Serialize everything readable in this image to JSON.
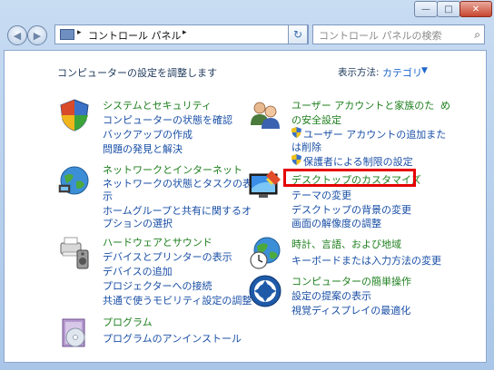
{
  "window": {
    "minimize_glyph": "—",
    "maximize_glyph": "□",
    "close_glyph": "✕"
  },
  "nav": {
    "back_glyph": "◀",
    "forward_glyph": "▶",
    "breadcrumb": "コントロール パネル",
    "sep_glyph": "▸",
    "dropdown_glyph": "▾",
    "refresh_glyph": "↻",
    "search_placeholder": "コントロール パネルの検索",
    "search_glyph": "⌕"
  },
  "header": {
    "heading": "コンピューターの設定を調整します",
    "view_label": "表示方法:",
    "view_value": "カテゴリ",
    "view_dropdown_glyph": "▼"
  },
  "categories": {
    "system": {
      "title": "システムとセキュリティ",
      "links": [
        "コンピューターの状態を確認",
        "バックアップの作成",
        "問題の発見と解決"
      ]
    },
    "network": {
      "title": "ネットワークとインターネット",
      "links": [
        "ネットワークの状態とタスクの表",
        "示",
        "ホームグループと共有に関するオ",
        "プションの選択"
      ]
    },
    "hardware": {
      "title": "ハードウェアとサウンド",
      "links": [
        "デバイスとプリンターの表示",
        "デバイスの追加",
        "プロジェクターへの接続",
        "共通で使うモビリティ設定の調整"
      ]
    },
    "programs": {
      "title": "プログラム",
      "links": [
        "プログラムのアンインストール"
      ]
    },
    "users": {
      "title_line1": "ユーザー アカウントと家族のた",
      "title_line2": "め",
      "title_line3": "の安全設定",
      "links": [
        "ユーザー アカウントの追加また",
        "は削除",
        "保護者による制限の設定"
      ]
    },
    "appearance": {
      "title": "デスクトップのカスタマイズ",
      "links": [
        "テーマの変更",
        "デスクトップの背景の変更",
        "画面の解像度の調整"
      ]
    },
    "clock": {
      "title": "時計、言語、および地域",
      "links": [
        "キーボードまたは入力方法の変更"
      ]
    },
    "ease": {
      "title": "コンピューターの簡単操作",
      "links": [
        "設定の提案の表示",
        "視覚ディスプレイの最適化"
      ]
    }
  },
  "colors": {
    "category_title": "#1d7f1d",
    "link": "#1a4fa6",
    "highlight": "#e60000",
    "accent": "#1e66cc"
  }
}
